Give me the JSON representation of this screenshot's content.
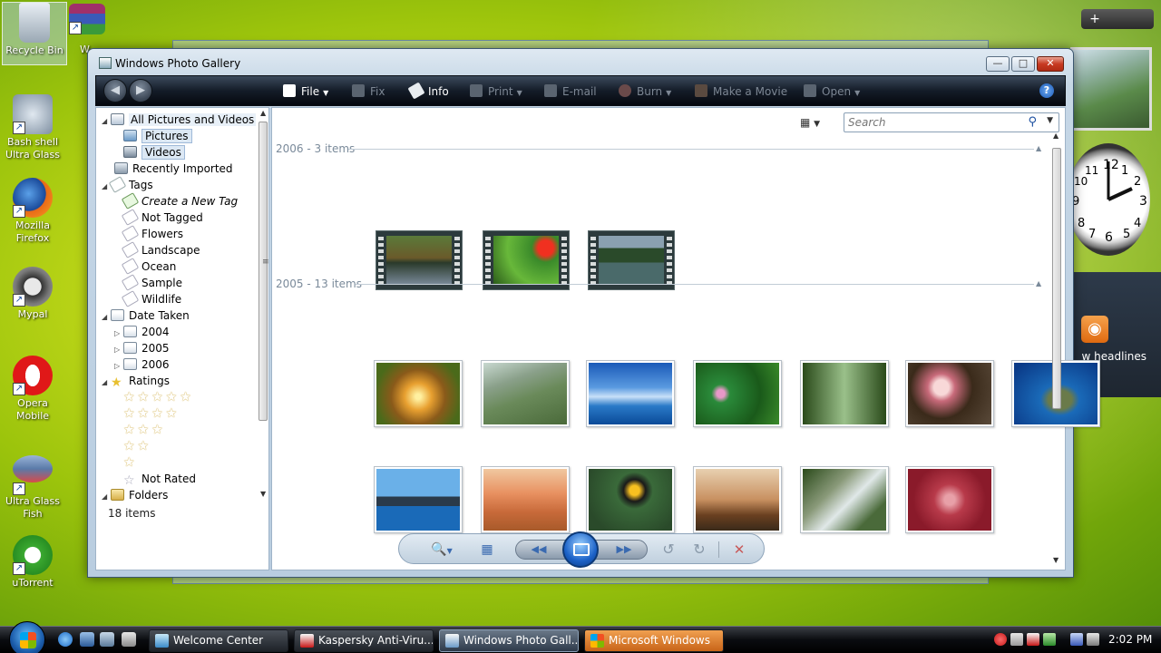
{
  "desktop": {
    "icons": [
      {
        "label": "Recycle Bin"
      },
      {
        "label": "W"
      },
      {
        "label": "Bash shell Ultra Glass"
      },
      {
        "label": "Mozilla Firefox"
      },
      {
        "label": "Mypal"
      },
      {
        "label": "Opera Mobile"
      },
      {
        "label": "Ultra Glass Fish"
      },
      {
        "label": "uTorrent"
      }
    ]
  },
  "gadgets": {
    "feed_text": "w headlines",
    "add_label": "+",
    "clock_numbers": [
      "12",
      "1",
      "2",
      "3",
      "4",
      "5",
      "6",
      "7",
      "8",
      "9",
      "10",
      "11"
    ]
  },
  "window": {
    "title": "Windows Photo Gallery",
    "controls": {
      "minimize": "—",
      "maximize": "□",
      "close": "✕"
    },
    "toolbar": {
      "back": "◀",
      "forward": "▶",
      "file": "File",
      "fix": "Fix",
      "info": "Info",
      "print": "Print",
      "email": "E-mail",
      "burn": "Burn",
      "make_movie": "Make a Movie",
      "open": "Open",
      "help": "?"
    },
    "nav": {
      "all": "All Pictures and Videos",
      "pictures": "Pictures",
      "videos": "Videos",
      "recently_imported": "Recently Imported",
      "tags": "Tags",
      "create_tag": "Create a New Tag",
      "not_tagged": "Not Tagged",
      "flowers": "Flowers",
      "landscape": "Landscape",
      "ocean": "Ocean",
      "sample": "Sample",
      "wildlife": "Wildlife",
      "date_taken": "Date Taken",
      "y2004": "2004",
      "y2005": "2005",
      "y2006": "2006",
      "ratings": "Ratings",
      "stars5": "★★★★★",
      "stars4": "★★★★",
      "stars3": "★★★",
      "stars2": "★★",
      "stars1": "★",
      "not_rated": "Not Rated",
      "folders": "Folders"
    },
    "status": "18 items",
    "search": {
      "placeholder": "Search",
      "icon": "search-icon"
    },
    "groups": [
      {
        "label": "2006 - 3 items"
      },
      {
        "label": "2005 - 13 items"
      }
    ],
    "playback": {
      "zoom": "🔍",
      "grid": "▦",
      "prev": "◀◀",
      "next": "▶▶",
      "rotate_ccw": "↺",
      "rotate_cw": "↻",
      "delete": "✕"
    }
  },
  "taskbar": {
    "tasks": [
      {
        "label": "Welcome Center"
      },
      {
        "label": "Kaspersky Anti-Viru..."
      },
      {
        "label": "Windows Photo Gall..."
      },
      {
        "label": "Microsoft Windows"
      }
    ],
    "clock": "2:02 PM"
  }
}
